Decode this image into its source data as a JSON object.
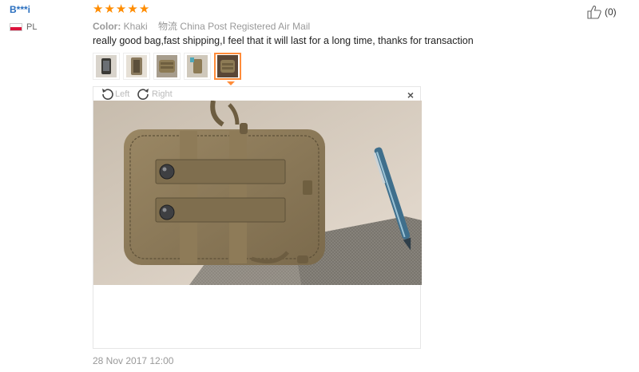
{
  "reviewer": {
    "name": "B***i",
    "country": "PL"
  },
  "rating": {
    "stars": 5,
    "max": 5
  },
  "attributes": {
    "color_label": "Color:",
    "color_value": "Khaki",
    "shipping_label": "物流",
    "shipping_value": "China Post Registered Air Mail"
  },
  "review": {
    "text": "really good bag,fast shipping,I feel that it will last for a long time, thanks for transaction",
    "date": "28 Nov 2017 12:00"
  },
  "helpful": {
    "count": "(0)"
  },
  "viewer": {
    "rotate_left": "Left",
    "rotate_right": "Right",
    "close": "×"
  },
  "thumbnails": {
    "count": 5,
    "selected_index": 4
  },
  "colors": {
    "accent": "#ff8c3a",
    "username": "#2a6fbf",
    "star": "#ff8c00"
  }
}
